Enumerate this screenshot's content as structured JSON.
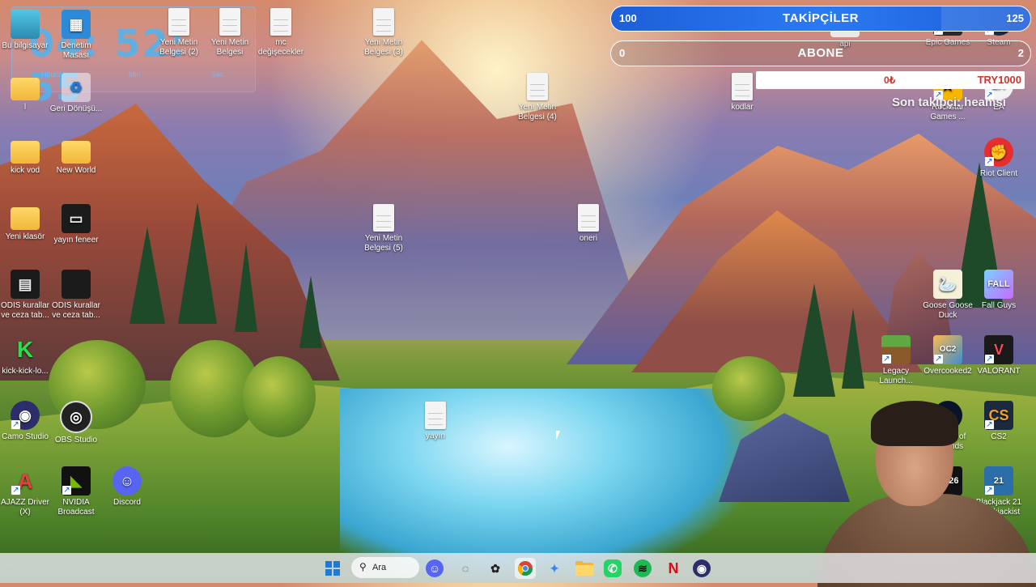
{
  "overlay": {
    "clock": {
      "hours": "04",
      "minutes": "52",
      "seconds": "55",
      "sep": ":",
      "hours_label": "Hours",
      "minutes_label": "Min",
      "seconds_label": "Sec"
    },
    "followers_bar": {
      "left_value": "100",
      "label": "TAKİPÇİLER",
      "right_value": "125"
    },
    "subs_bar": {
      "left_value": "0",
      "label": "ABONE",
      "right_value": "2"
    },
    "donation": {
      "current": "0₺",
      "goal": "TRY1000"
    },
    "last_follower": "Son takipçi: heamsi"
  },
  "desktop_icons_left": [
    {
      "label": "Bu bilgisayar",
      "icon": "pc-icon"
    },
    {
      "label": "Denetim Masası",
      "icon": "control-panel-icon"
    },
    {
      "label": "l",
      "icon": "folder-icon"
    },
    {
      "label": "Geri Dönüşü...",
      "icon": "recycle-bin-icon"
    },
    {
      "label": "kick vod",
      "icon": "folder-icon"
    },
    {
      "label": "New World",
      "icon": "folder-icon"
    },
    {
      "label": "Yeni klasör",
      "icon": "folder-image-icon"
    },
    {
      "label": "yayın feneer",
      "icon": "screenshot-icon"
    },
    {
      "label": "ODIS kurallar ve ceza tab...",
      "icon": "calculator-icon"
    },
    {
      "label": "ODIS kurallar ve ceza tab...",
      "icon": "document-dark-icon"
    },
    {
      "label": "kick-kick-lo...",
      "icon": "kick-icon"
    },
    {
      "label": "Camo Studio",
      "icon": "camo-icon"
    },
    {
      "label": "OBS Studio",
      "icon": "obs-icon"
    },
    {
      "label": "AJAZZ Driver (X)",
      "icon": "ajazz-icon"
    },
    {
      "label": "NVIDIA Broadcast",
      "icon": "nvidia-icon"
    },
    {
      "label": "Discord",
      "icon": "discord-icon"
    }
  ],
  "desktop_icons_docs": [
    {
      "label": "Yeni Metin Belgesi (2)"
    },
    {
      "label": "Yeni Metin Belgesi"
    },
    {
      "label": "mc değişecekler"
    },
    {
      "label": "Yeni Metin Belgesi (3)"
    },
    {
      "label": "Yeni Metin Belgesi (4)"
    },
    {
      "label": "Yeni Metin Belgesi (5)"
    },
    {
      "label": "oneri"
    },
    {
      "label": "yayın"
    },
    {
      "label": "kodlar"
    }
  ],
  "desktop_icons_right": [
    {
      "label": "api",
      "icon": "api-icon"
    },
    {
      "label": "Epic Games",
      "icon": "epic-icon"
    },
    {
      "label": "Steam",
      "icon": "steam-icon"
    },
    {
      "label": "Rockstar Games ...",
      "icon": "rockstar-icon"
    },
    {
      "label": "EA",
      "icon": "ea-icon"
    },
    {
      "label": "Riot Client",
      "icon": "riot-icon"
    },
    {
      "label": "Goose Goose Duck",
      "icon": "goose-icon"
    },
    {
      "label": "Fall Guys",
      "icon": "fallguys-icon"
    },
    {
      "label": "Legacy Launch...",
      "icon": "minecraft-icon"
    },
    {
      "label": "Overcooked2",
      "icon": "overcooked-icon"
    },
    {
      "label": "VALORANT",
      "icon": "valorant-icon"
    },
    {
      "label": "League of Legends",
      "icon": "lol-icon"
    },
    {
      "label": "CS2",
      "icon": "cs2-icon"
    },
    {
      "label": "FC26",
      "icon": "fc26-icon"
    },
    {
      "label": "Blackjack 21 Blackjackist",
      "icon": "blackjack-icon"
    }
  ],
  "taskbar": {
    "search_label": "Ara",
    "items": [
      "windows-start-icon",
      "search-icon",
      "discord-icon",
      "davinci-icon",
      "chatgpt-icon",
      "chrome-icon",
      "copilot-icon",
      "file-explorer-icon",
      "whatsapp-icon",
      "spotify-icon",
      "netflix-icon",
      "camo-icon"
    ]
  }
}
